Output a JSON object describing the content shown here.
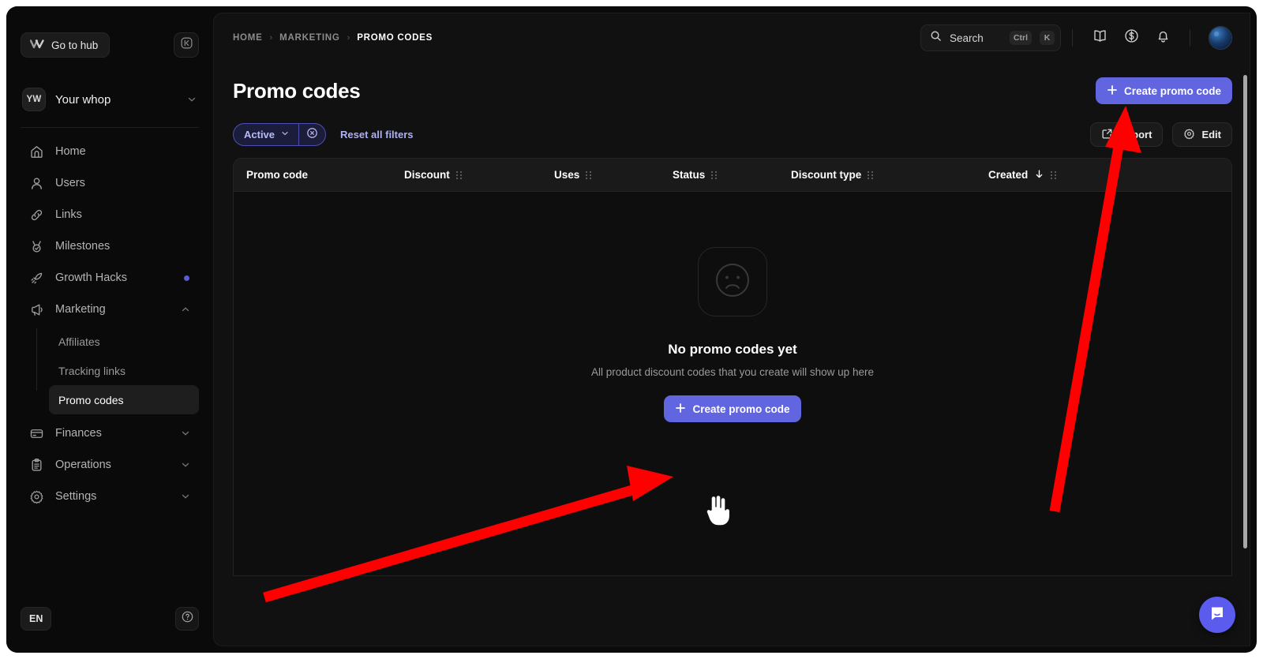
{
  "sidebar": {
    "hub_button": {
      "label": "Go to hub",
      "icon": "whop-logo-icon"
    },
    "collapse_button": {
      "icon": "collapse-panel-icon"
    },
    "workspace": {
      "initials": "YW",
      "name": "Your whop",
      "chevron": "chevron-down-icon"
    },
    "items": [
      {
        "label": "Home",
        "icon": "home-icon",
        "type": "link"
      },
      {
        "label": "Users",
        "icon": "user-icon",
        "type": "link"
      },
      {
        "label": "Links",
        "icon": "link-icon",
        "type": "link"
      },
      {
        "label": "Milestones",
        "icon": "milestone-icon",
        "type": "link"
      },
      {
        "label": "Growth Hacks",
        "icon": "rocket-icon",
        "type": "link",
        "badge_dot": true
      },
      {
        "label": "Marketing",
        "icon": "megaphone-icon",
        "type": "group",
        "expanded": true
      }
    ],
    "marketing_children": [
      {
        "label": "Affiliates",
        "active": false
      },
      {
        "label": "Tracking links",
        "active": false
      },
      {
        "label": "Promo codes",
        "active": true
      }
    ],
    "items_after": [
      {
        "label": "Finances",
        "icon": "credit-card-icon",
        "type": "group",
        "expanded": false
      },
      {
        "label": "Operations",
        "icon": "clipboard-icon",
        "type": "group",
        "expanded": false
      },
      {
        "label": "Settings",
        "icon": "gear-icon",
        "type": "group",
        "expanded": false
      }
    ],
    "language_button": "EN",
    "help_button": {
      "icon": "question-circle-icon"
    }
  },
  "topbar": {
    "breadcrumb": [
      {
        "label": "HOME",
        "current": false
      },
      {
        "label": "MARKETING",
        "current": false
      },
      {
        "label": "PROMO CODES",
        "current": true
      }
    ],
    "separator": "›",
    "search": {
      "placeholder": "Search",
      "icon": "search-icon",
      "shortcut_modifier": "Ctrl",
      "shortcut_key": "K"
    },
    "actions": [
      {
        "name": "docs-button",
        "icon": "book-icon"
      },
      {
        "name": "earnings-button",
        "icon": "dollar-circle-icon"
      },
      {
        "name": "notifications-button",
        "icon": "bell-icon"
      }
    ],
    "avatar": {
      "name": "user-avatar"
    }
  },
  "page": {
    "title": "Promo codes",
    "create_button": {
      "label": "Create promo code",
      "icon": "plus-icon"
    }
  },
  "filters": {
    "active_pill": {
      "label": "Active",
      "chevron": "chevron-down-icon",
      "clear_icon": "circle-x-icon"
    },
    "reset_label": "Reset all filters",
    "export_button": {
      "label": "Export",
      "icon": "external-link-icon"
    },
    "edit_button": {
      "label": "Edit",
      "icon": "gear-icon"
    }
  },
  "table": {
    "columns": [
      {
        "label": "Promo code",
        "grip": false,
        "sorted": false
      },
      {
        "label": "Discount",
        "grip": true,
        "sorted": false
      },
      {
        "label": "Uses",
        "grip": true,
        "sorted": false
      },
      {
        "label": "Status",
        "grip": true,
        "sorted": false
      },
      {
        "label": "Discount type",
        "grip": true,
        "sorted": false
      },
      {
        "label": "Created",
        "grip": true,
        "sorted": true,
        "sort_icon": "arrow-down-icon"
      }
    ],
    "rows": [],
    "empty_state": {
      "icon": "sad-face-icon",
      "title": "No promo codes yet",
      "subtitle": "All product discount codes that you create will show up here",
      "button": {
        "label": "Create promo code",
        "icon": "plus-icon"
      }
    }
  },
  "chat_widget": {
    "name": "intercom-chat-button",
    "icon": "chat-bubble-icon"
  },
  "colors": {
    "accent": "#6165e0",
    "accent_soft": "#b9bcf5",
    "annotation": "#ff0000",
    "chat": "#5b5bed"
  },
  "annotations": [
    {
      "name": "arrow-to-create-button-top",
      "color": "#ff0000"
    },
    {
      "name": "arrow-to-create-button-center",
      "color": "#ff0000"
    }
  ],
  "cursor": {
    "name": "hand-pointer-cursor"
  }
}
